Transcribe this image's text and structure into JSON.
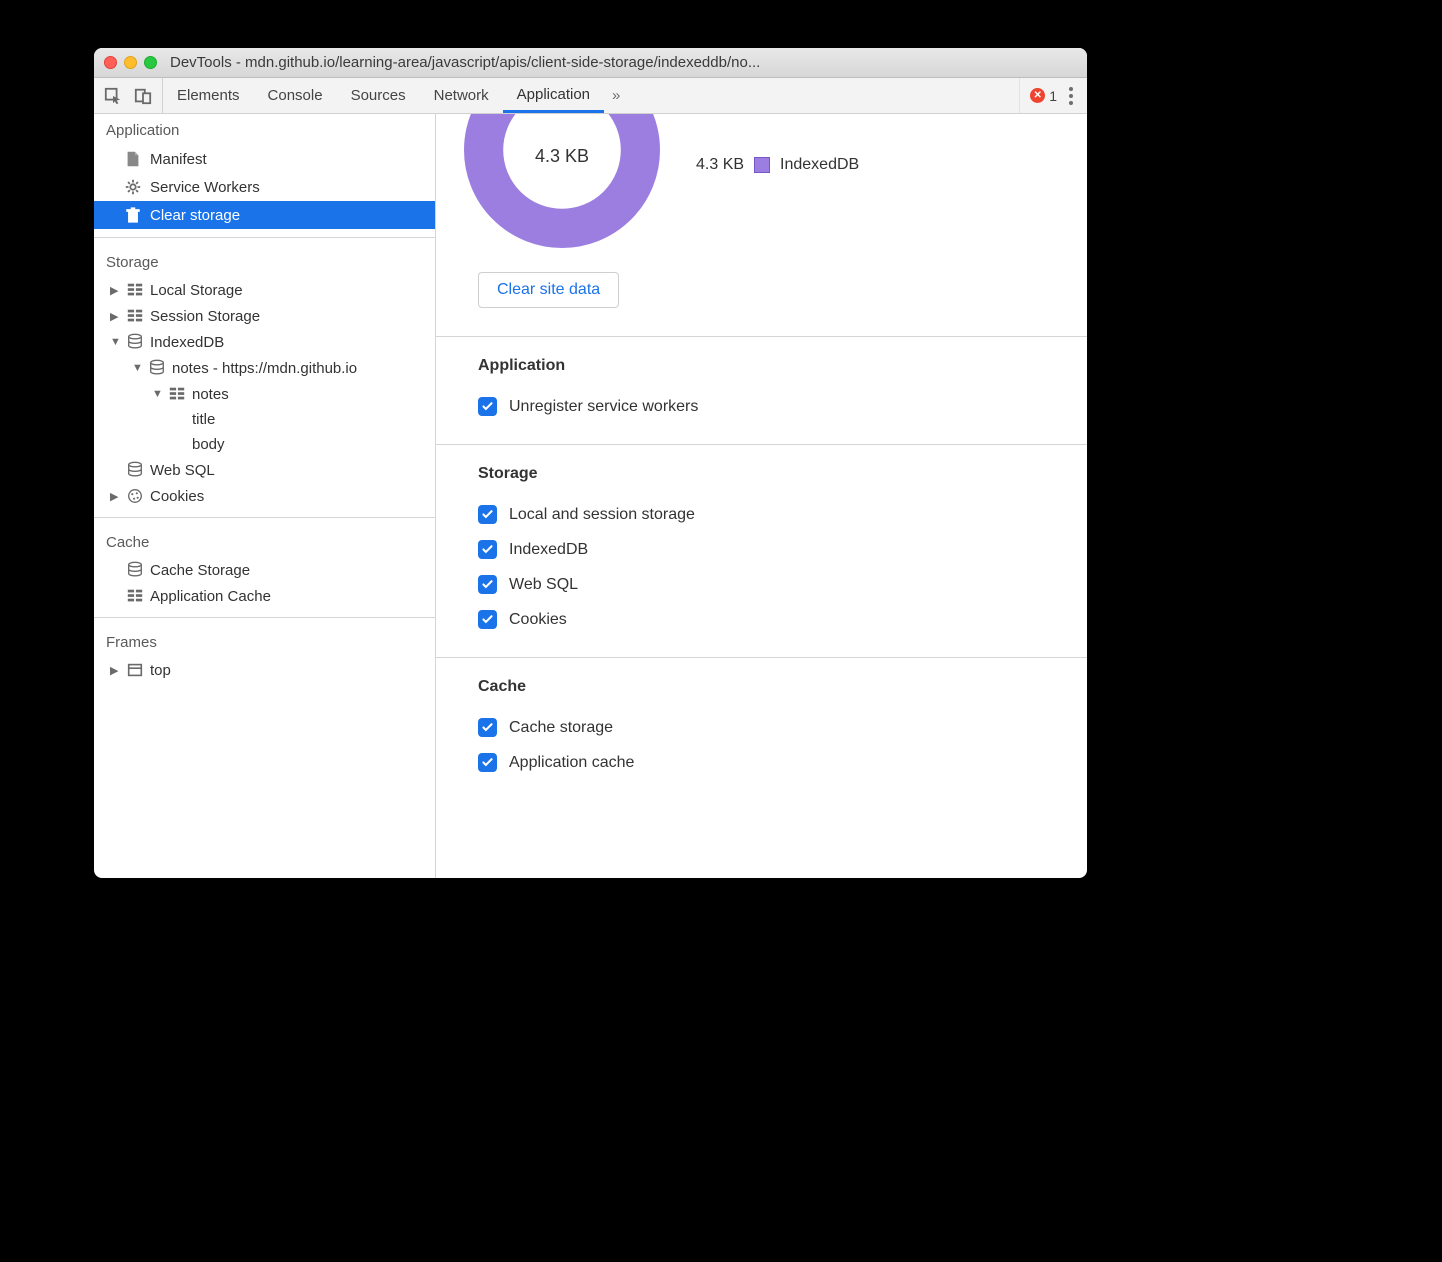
{
  "window_title": "DevTools - mdn.github.io/learning-area/javascript/apis/client-side-storage/indexeddb/no...",
  "tabs": {
    "elements": "Elements",
    "console": "Console",
    "sources": "Sources",
    "network": "Network",
    "application": "Application"
  },
  "error_count": "1",
  "sidebar": {
    "application": {
      "title": "Application",
      "manifest": "Manifest",
      "service_workers": "Service Workers",
      "clear_storage": "Clear storage"
    },
    "storage": {
      "title": "Storage",
      "local_storage": "Local Storage",
      "session_storage": "Session Storage",
      "indexeddb": "IndexedDB",
      "db_notes": "notes - https://mdn.github.io",
      "table_notes": "notes",
      "col_title": "title",
      "col_body": "body",
      "websql": "Web SQL",
      "cookies": "Cookies"
    },
    "cache": {
      "title": "Cache",
      "cache_storage": "Cache Storage",
      "app_cache": "Application Cache"
    },
    "frames": {
      "title": "Frames",
      "top": "top"
    }
  },
  "main": {
    "usage_total": "4.3 KB",
    "legend_value": "4.3 KB",
    "legend_label": "IndexedDB",
    "clear_button": "Clear site data",
    "section_application": {
      "title": "Application",
      "unregister_sw": "Unregister service workers"
    },
    "section_storage": {
      "title": "Storage",
      "local_session": "Local and session storage",
      "indexeddb": "IndexedDB",
      "websql": "Web SQL",
      "cookies": "Cookies"
    },
    "section_cache": {
      "title": "Cache",
      "cache_storage": "Cache storage",
      "app_cache": "Application cache"
    }
  },
  "colors": {
    "accent": "#1a73e8",
    "donut": "#9c7ee0"
  }
}
